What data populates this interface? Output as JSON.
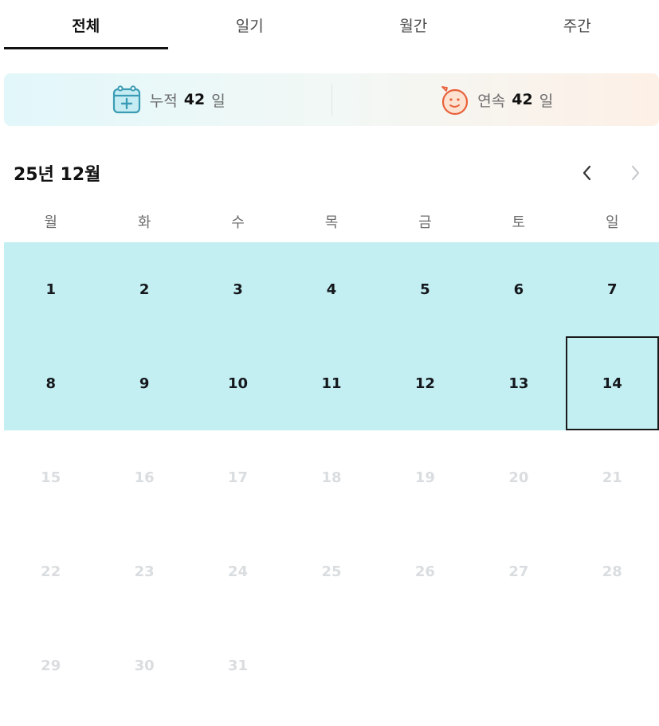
{
  "tabs": [
    {
      "label": "전체",
      "active": true
    },
    {
      "label": "일기",
      "active": false
    },
    {
      "label": "월간",
      "active": false
    },
    {
      "label": "주간",
      "active": false
    }
  ],
  "stats": {
    "total": {
      "label": "누적",
      "value": "42",
      "unit": "일",
      "icon": "calendar-plus-icon"
    },
    "streak": {
      "label": "연속",
      "value": "42",
      "unit": "일",
      "icon": "smiley-face-icon"
    }
  },
  "calendar": {
    "title": "25년 12월",
    "prev_icon": "chevron-left-icon",
    "next_icon": "chevron-right-icon",
    "weekdays": [
      "월",
      "화",
      "수",
      "목",
      "금",
      "토",
      "일"
    ],
    "days": [
      {
        "label": "1",
        "state": "active"
      },
      {
        "label": "2",
        "state": "active"
      },
      {
        "label": "3",
        "state": "active"
      },
      {
        "label": "4",
        "state": "active"
      },
      {
        "label": "5",
        "state": "active"
      },
      {
        "label": "6",
        "state": "active"
      },
      {
        "label": "7",
        "state": "active"
      },
      {
        "label": "8",
        "state": "active"
      },
      {
        "label": "9",
        "state": "active"
      },
      {
        "label": "10",
        "state": "active"
      },
      {
        "label": "11",
        "state": "active"
      },
      {
        "label": "12",
        "state": "active"
      },
      {
        "label": "13",
        "state": "active"
      },
      {
        "label": "14",
        "state": "today"
      },
      {
        "label": "15",
        "state": "future"
      },
      {
        "label": "16",
        "state": "future"
      },
      {
        "label": "17",
        "state": "future"
      },
      {
        "label": "18",
        "state": "future"
      },
      {
        "label": "19",
        "state": "future"
      },
      {
        "label": "20",
        "state": "future"
      },
      {
        "label": "21",
        "state": "future"
      },
      {
        "label": "22",
        "state": "future"
      },
      {
        "label": "23",
        "state": "future"
      },
      {
        "label": "24",
        "state": "future"
      },
      {
        "label": "25",
        "state": "future"
      },
      {
        "label": "26",
        "state": "future"
      },
      {
        "label": "27",
        "state": "future"
      },
      {
        "label": "28",
        "state": "future"
      },
      {
        "label": "29",
        "state": "future"
      },
      {
        "label": "30",
        "state": "future"
      },
      {
        "label": "31",
        "state": "future"
      }
    ]
  },
  "colors": {
    "active_day": "#c3eef2",
    "future_text": "#dadde0",
    "calendar_icon": "#3a9cb4",
    "smiley_icon": "#e8613a"
  }
}
